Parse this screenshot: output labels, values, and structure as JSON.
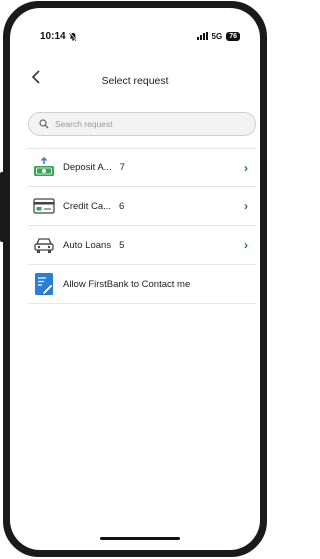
{
  "status_bar": {
    "time": "10:14",
    "network": "5G",
    "battery": "76"
  },
  "header": {
    "back_icon": "back-chevron-icon",
    "title": "Select request"
  },
  "search": {
    "placeholder": "Search request",
    "value": ""
  },
  "requests": [
    {
      "label": "Deposit A...",
      "count": "7",
      "icon": "deposit-icon",
      "has_chevron": true
    },
    {
      "label": "Credit Ca...",
      "count": "6",
      "icon": "credit-card-icon",
      "has_chevron": true
    },
    {
      "label": "Auto Loans",
      "count": "5",
      "icon": "car-icon",
      "has_chevron": true
    },
    {
      "label": "Allow FirstBank to Contact me",
      "count": "",
      "icon": "contact-form-icon",
      "has_chevron": false
    }
  ],
  "colors": {
    "accent": "#1e7a43",
    "icon_green": "#3aa35a",
    "icon_blue": "#2a7fd4"
  }
}
